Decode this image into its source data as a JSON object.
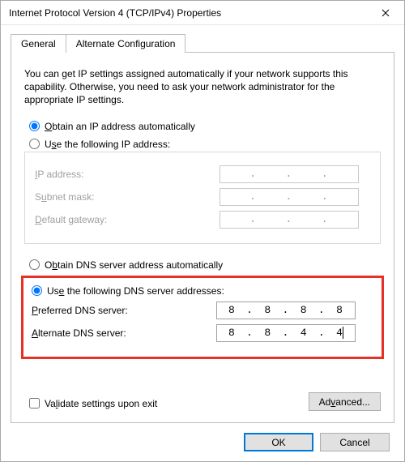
{
  "window": {
    "title": "Internet Protocol Version 4 (TCP/IPv4) Properties"
  },
  "tabs": {
    "general": "General",
    "alternate": "Alternate Configuration"
  },
  "intro": "You can get IP settings assigned automatically if your network supports this capability. Otherwise, you need to ask your network administrator for the appropriate IP settings.",
  "ipSection": {
    "autoLabel": "Obtain an IP address automatically",
    "manualLabel": "Use the following IP address:",
    "fields": {
      "ipAddress": "IP address:",
      "subnet": "Subnet mask:",
      "gateway": "Default gateway:"
    }
  },
  "dnsSection": {
    "autoLabel": "Obtain DNS server address automatically",
    "manualLabel": "Use the following DNS server addresses:",
    "fields": {
      "preferred": "Preferred DNS server:",
      "alternate": "Alternate DNS server:"
    },
    "values": {
      "preferred": [
        "8",
        "8",
        "8",
        "8"
      ],
      "alternate": [
        "8",
        "8",
        "4",
        "4"
      ]
    }
  },
  "validateLabel": "Validate settings upon exit",
  "buttons": {
    "advanced": "Advanced...",
    "ok": "OK",
    "cancel": "Cancel"
  }
}
